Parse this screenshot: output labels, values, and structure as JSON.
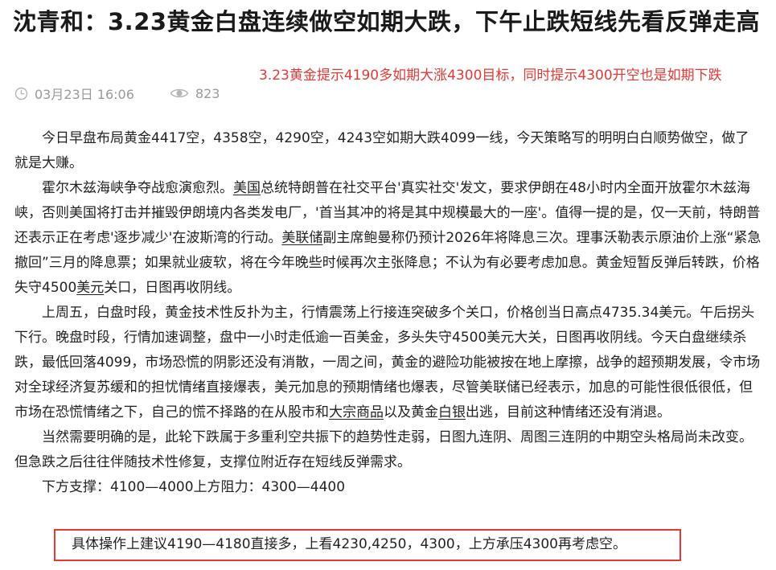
{
  "article": {
    "title": "沈青和：3.23黄金白盘连续做空如期大跌，下午止跌短线先看反弹走高",
    "date": "03月23日 16:06",
    "views": "823"
  },
  "annotation": {
    "text": "3.23黄金提示4190多如期大涨4300目标，同时提示4300开空也是如期下跌",
    "color": "#e53935"
  },
  "icons": {
    "clock": "clock-icon",
    "views": "eye-icon"
  },
  "body": {
    "p1": "今日早盘布局黄金4417空，4358空，4290空，4243空如期大跌4099一线，今天策略写的明明白白顺势做空，做了就是大赚。",
    "p2": {
      "t1": "霍尔木兹海峡争夺战愈演愈烈。",
      "l1": "美国",
      "t2": "总统特朗普在社交平台'真实社交'发文，要求伊朗在48小时内全面开放霍尔木兹海峡，否则美国将打击并摧毁伊朗境内各类发电厂，'首当其冲的将是其中规模最大的一座'。值得一提的是，仅一天前，特朗普还表示正在考虑'逐步减少'在波斯湾的行动。",
      "l2": "美联储",
      "t3": "副主席鲍曼称仍预计2026年将降息三次。理事沃勒表示原油价上涨“紧急撤回”三月的降息票；如果就业疲软，将在今年晚些时候再次主张降息；不认为有必要考虑加息。黄金短暂反弹后转跌，价格失守4500",
      "l3": "美元",
      "t4": "关口，日图再收阴线。"
    },
    "p3": {
      "t1": "上周五，白盘时段，黄金技术性反扑为主，行情震荡上行接连突破多个关口，价格创当日高点4735.34美元。午后拐头下行。晚盘时段，行情加速调整，盘中一小时走低逾一百美金，多头失守4500美元大关，日图再收阴线。今天白盘继续杀跌，最低回落4099，市场恐慌的阴影还没有消散，一周之间，黄金的避险功能被按在地上摩擦，战争的超预期发展，令市场对全球经济复苏缓和的担忧情绪直接爆表，美元加息的预期情绪也爆表，尽管美联储已经表示，加息的可能性很低很低，但市场在恐慌情绪之下，自己的慌不择路的在从股市和",
      "l1": "大宗商品",
      "t2": "以及黄金",
      "l2": "白银",
      "t3": "出逃，目前这种情绪还没有消退。"
    },
    "p4": "当然需要明确的是，此轮下跌属于多重利空共振下的趋势性走弱，日图九连阴、周图三连阴的中期空头格局尚未改变。但急跌之后往往伴随技术性修复，支撑位附近存在短线反弹需求。",
    "p5": "下方支撑：4100—4000上方阻力：4300—4400",
    "p6": "具体操作上建议4190—4180直接多，上看4230,4250，4300，上方承压4300再考虑空。"
  }
}
